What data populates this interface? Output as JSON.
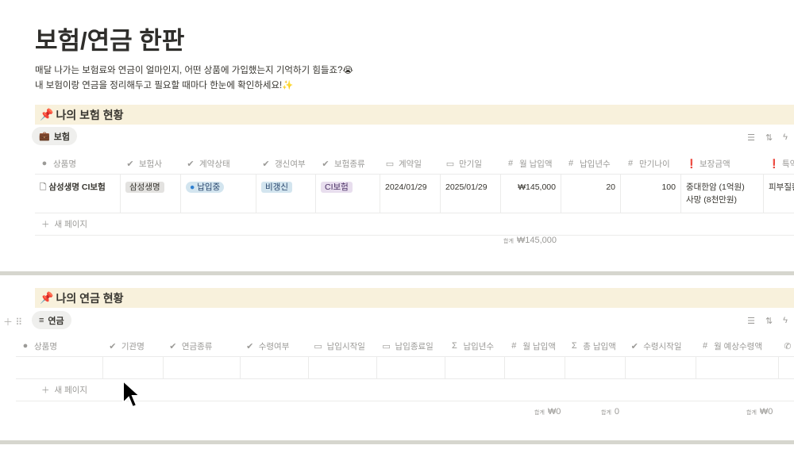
{
  "title": "보험/연금 한판",
  "description": [
    "매달 나가는 보험료와 연금이 얼마인지, 어떤 상품에 가입했는지 기억하기 힘들죠?😭",
    "내 보험이랑 연금을 정리해두고 필요할 때마다 한눈에 확인하세요!✨"
  ],
  "insurance": {
    "callout": "나의 보험 현황",
    "view": "보험",
    "columns": [
      "상품명",
      "보험사",
      "계약상태",
      "갱신여부",
      "보험종류",
      "계약일",
      "만기일",
      "월 납입액",
      "납입년수",
      "만기나이",
      "보장금액",
      "특약"
    ],
    "row": {
      "name": "삼성생명 CI보험",
      "company": "삼성생명",
      "status": "납입중",
      "renewal": "비갱신",
      "type": "CI보험",
      "start": "2024/01/29",
      "end": "2025/01/29",
      "monthly": "₩145,000",
      "years": "20",
      "age": "100",
      "coverage1": "중대한암 (1억원)",
      "coverage2": "사망 (8천만원)",
      "rider": "피부질환"
    },
    "new_page": "새 페이지",
    "sum_label": "합계",
    "sum_value": "₩145,000"
  },
  "pension": {
    "callout": "나의 연금 현황",
    "view": "연금",
    "columns": [
      "상품명",
      "기관명",
      "연금종류",
      "수령여부",
      "납입시작일",
      "납입종료일",
      "납입년수",
      "월 납입액",
      "총 납입액",
      "수령시작일",
      "월 예상수령액"
    ],
    "new_page": "새 페이지",
    "sums": [
      {
        "label": "합계",
        "value": "₩0"
      },
      {
        "label": "합계",
        "value": "0"
      },
      {
        "label": "합계",
        "value": "₩0"
      }
    ]
  },
  "colors": {
    "callout": "#f8f1dc",
    "status_tag": "#d3e5ef",
    "renewal_tag": "#d3e5ef",
    "type_tag": "#e8deee",
    "company_tag": "#e3e2e0"
  }
}
